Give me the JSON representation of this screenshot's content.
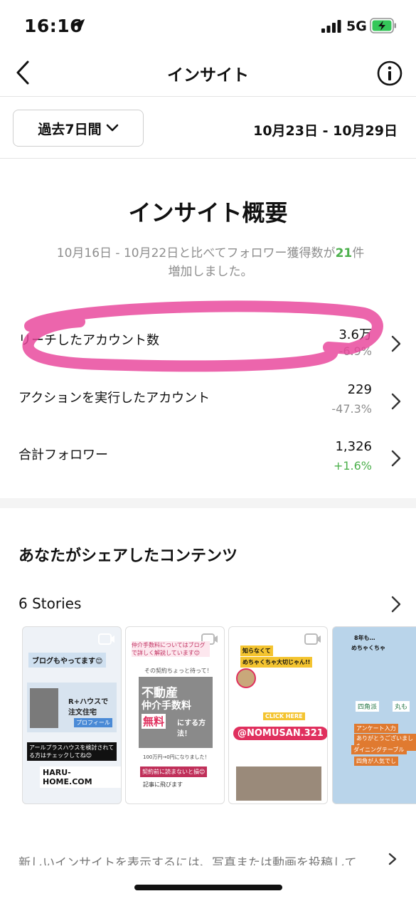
{
  "status_bar": {
    "time": "16:16",
    "network": "5G"
  },
  "nav": {
    "title": "インサイト",
    "back_icon": "chevron-left-icon",
    "info_icon": "info-icon"
  },
  "period": {
    "selected": "過去7日間",
    "date_range": "10月23日 - 10月29日"
  },
  "overview": {
    "title": "インサイト概要",
    "desc_prefix": "10月16日 - 10月22日と比べてフォロワー獲得数が",
    "desc_number": "21",
    "desc_suffix": "件",
    "desc_line2": "増加しました。"
  },
  "metrics": [
    {
      "label": "リーチしたアカウント数",
      "value": "3.6万",
      "change": "-6.9%",
      "change_color": "#8e8e8e"
    },
    {
      "label": "アクションを実行したアカウント",
      "value": "229",
      "change": "-47.3%",
      "change_color": "#8e8e8e"
    },
    {
      "label": "合計フォロワー",
      "value": "1,326",
      "change": "+1.6%",
      "change_color": "#4cb04c"
    }
  ],
  "content": {
    "title": "あなたがシェアしたコンテンツ",
    "stories_label": "6 Stories",
    "stories": [
      {
        "lines": [
          "ブログもやってます😊",
          "R+ハウスで注文住宅",
          "プロフィール",
          "アールプラスハウスを検討されてる方はチェックしてね😊",
          "HARU-HOME.COM"
        ]
      },
      {
        "lines": [
          "仲介手数料についてはブログで詳しく解説しています😊",
          "その契約ちょっと待って！",
          "不動産",
          "仲介手数料",
          "無料",
          "にする方法！",
          "100万円→0円になりました！",
          "契約前に読まないと損😊",
          "記事に飛びます"
        ]
      },
      {
        "lines": [
          "知らなくて",
          "めちゃくちゃ大切じゃん!!",
          "CLICK HERE",
          "@NOMUSAN.321"
        ]
      },
      {
        "lines": [
          "8年も…",
          "めちゃくちゃ",
          "四角派",
          "丸も",
          "アンケート入力",
          "ありがとうございました",
          "ダイニングテーブル",
          "四角が人気でし"
        ]
      }
    ]
  },
  "footer": {
    "text": "新しいインサイトを表示するには、写真または動画を投稿して"
  },
  "colors": {
    "accent_green": "#4cb04c",
    "highlight_pink": "#e8439a"
  }
}
